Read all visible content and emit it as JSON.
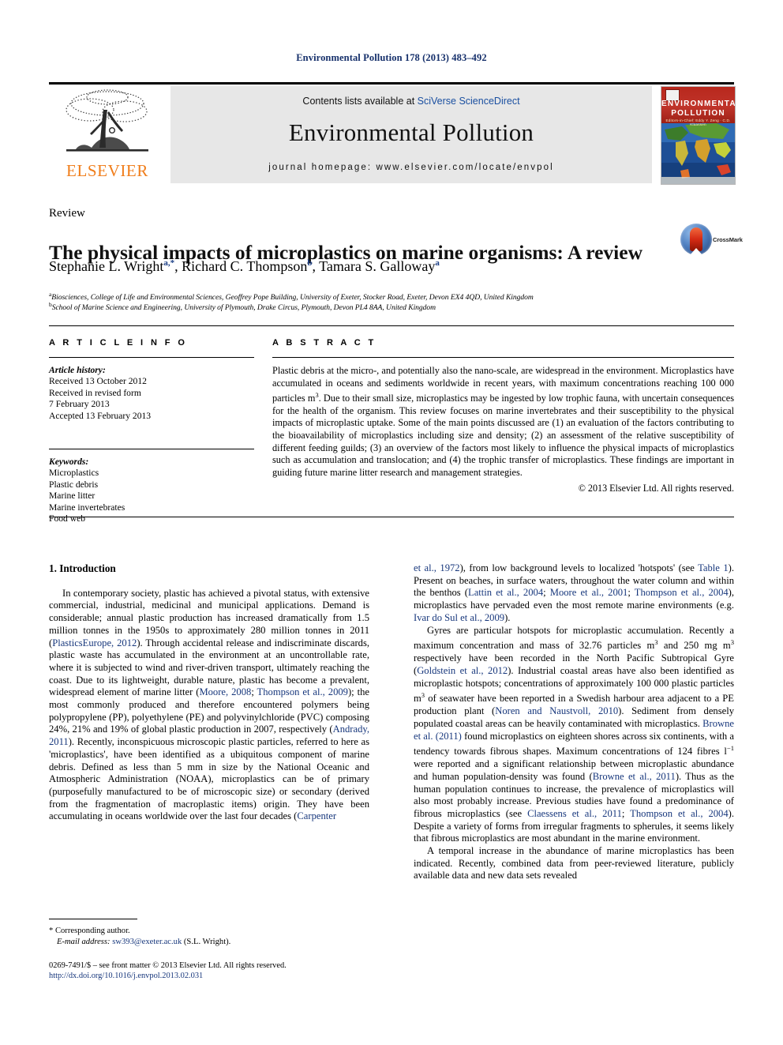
{
  "running_head": "Environmental Pollution 178 (2013) 483–492",
  "masthead": {
    "contents_prefix": "Contents lists available at ",
    "contents_link": "SciVerse ScienceDirect",
    "journal_title": "Environmental Pollution",
    "homepage": "journal homepage: www.elsevier.com/locate/envpol",
    "publisher_name": "ELSEVIER",
    "cover": {
      "line1": "ENVIRONMENTAL",
      "line2": "POLLUTION",
      "sub": "Editors-in-Chief:  Eddy Y. Zeng   · C.D. Klaassen"
    }
  },
  "article": {
    "type": "Review",
    "title": "The physical impacts of microplastics on marine organisms: A review",
    "crossmark_label": "CrossMark",
    "authors": [
      {
        "name": "Stephanie L. Wright",
        "marks": "a,*"
      },
      {
        "name": "Richard C. Thompson",
        "marks": "b"
      },
      {
        "name": "Tamara S. Galloway",
        "marks": "a"
      }
    ],
    "affiliations": [
      {
        "mark": "a",
        "text": "Biosciences, College of Life and Environmental Sciences, Geoffrey Pope Building, University of Exeter, Stocker Road, Exeter, Devon EX4 4QD, United Kingdom"
      },
      {
        "mark": "b",
        "text": "School of Marine Science and Engineering, University of Plymouth, Drake Circus, Plymouth, Devon PL4 8AA, United Kingdom"
      }
    ]
  },
  "article_info": {
    "heading": "A R T I C L E   I N F O",
    "history_label": "Article history:",
    "history": [
      "Received 13 October 2012",
      "Received in revised form",
      "7 February 2013",
      "Accepted 13 February 2013"
    ],
    "keywords_label": "Keywords:",
    "keywords": [
      "Microplastics",
      "Plastic debris",
      "Marine litter",
      "Marine invertebrates",
      "Food web"
    ]
  },
  "abstract": {
    "heading": "A B S T R A C T",
    "paragraph_1": "Plastic debris at the micro-, and potentially also the nano-scale, are widespread in the environment. Microplastics have accumulated in oceans and sediments worldwide in recent years, with maximum concentrations reaching 100 000 particles m",
    "paragraph_1_sup": "3",
    "paragraph_2": ". Due to their small size, microplastics may be ingested by low trophic fauna, with uncertain consequences for the health of the organism. This review focuses on marine invertebrates and their susceptibility to the physical impacts of microplastic uptake. Some of the main points discussed are (1) an evaluation of the factors contributing to the bioavailability of microplastics including size and density; (2) an assessment of the relative susceptibility of different feeding guilds; (3) an overview of the factors most likely to influence the physical impacts of microplastics such as accumulation and translocation; and (4) the trophic transfer of microplastics. These findings are important in guiding future marine litter research and management strategies.",
    "copyright": "© 2013 Elsevier Ltd. All rights reserved."
  },
  "body": {
    "section_title": "1. Introduction",
    "left": {
      "p1_a": "In contemporary society, plastic has achieved a pivotal status, with extensive commercial, industrial, medicinal and municipal applications. Demand is considerable; annual plastic production has increased dramatically from 1.5 million tonnes in the 1950s to approximately 280 million tonnes in 2011 (",
      "p1_ref1": "PlasticsEurope, 2012",
      "p1_b": "). Through accidental release and indiscriminate discards, plastic waste has accumulated in the environment at an uncontrollable rate, where it is subjected to wind and river-driven transport, ultimately reaching the coast. Due to its lightweight, durable nature, plastic has become a prevalent, widespread element of marine litter (",
      "p1_ref2": "Moore, 2008",
      "p1_c": "; ",
      "p1_ref3": "Thompson et al., 2009",
      "p1_d": "); the most commonly produced and therefore encountered polymers being polypropylene (PP), polyethylene (PE) and polyvinylchloride (PVC) composing 24%, 21% and 19% of global plastic production in 2007, respectively (",
      "p1_ref4": "Andrady, 2011",
      "p1_e": "). Recently, inconspicuous microscopic plastic particles, referred to here as 'microplastics', have been identified as a ubiquitous component of marine debris. Defined as less than 5 mm in size by the National Oceanic and Atmospheric Administration (NOAA), microplastics can be of primary (purposefully manufactured to be of microscopic size) or secondary (derived from the fragmentation of macroplastic items) origin. They have been accumulating in oceans worldwide over the last four decades (",
      "p1_ref5": "Carpenter"
    },
    "right": {
      "p1_a": "et al., 1972",
      "p1_b": "), from low background levels to localized 'hotspots' (see ",
      "p1_ref_table": "Table 1",
      "p1_c": "). Present on beaches, in surface waters, throughout the water column and within the benthos (",
      "p1_ref1": "Lattin et al., 2004",
      "p1_d": "; ",
      "p1_ref2": "Moore et al., 2001",
      "p1_e": "; ",
      "p1_ref3": "Thompson et al., 2004",
      "p1_f": "), microplastics have pervaded even the most remote marine environments (e.g. ",
      "p1_ref4": "Ivar do Sul et al., 2009",
      "p1_g": ").",
      "p2_a": "Gyres are particular hotspots for microplastic accumulation. Recently a maximum concentration and mass of 32.76 particles m",
      "p2_sup1": "3",
      "p2_b": " and 250 mg m",
      "p2_sup2": "3",
      "p2_c": " respectively have been recorded in the North Pacific Subtropical Gyre (",
      "p2_ref1": "Goldstein et al., 2012",
      "p2_d": "). Industrial coastal areas have also been identified as microplastic hotspots; concentrations of approximately 100 000 plastic particles m",
      "p2_sup3": "3",
      "p2_e": " of seawater have been reported in a Swedish harbour area adjacent to a PE production plant (",
      "p2_ref2": "Noren and Naustvoll, 2010",
      "p2_f": "). Sediment from densely populated coastal areas can be heavily contaminated with microplastics. ",
      "p2_ref3": "Browne et al. (2011)",
      "p2_g": " found microplastics on eighteen shores across six continents, with a tendency towards fibrous shapes. Maximum concentrations of 124 fibres l",
      "p2_sup4": "−1",
      "p2_h": " were reported and a significant relationship between microplastic abundance and human population-density was found (",
      "p2_ref4": "Browne et al., 2011",
      "p2_i": "). Thus as the human population continues to increase, the prevalence of microplastics will also most probably increase. Previous studies have found a predominance of fibrous microplastics (see ",
      "p2_ref5": "Claessens et al., 2011",
      "p2_j": "; ",
      "p2_ref6": "Thompson et al., 2004",
      "p2_k": "). Despite a variety of forms from irregular fragments to spherules, it seems likely that fibrous microplastics are most abundant in the marine environment.",
      "p3": "A temporal increase in the abundance of marine microplastics has been indicated. Recently, combined data from peer-reviewed literature, publicly available data and new data sets revealed"
    }
  },
  "footnotes": {
    "corresponding": "* Corresponding author.",
    "email_label": "E-mail address:",
    "email": "sw393@exeter.ac.uk",
    "email_suffix": "(S.L. Wright)."
  },
  "imprint": {
    "line1": "0269-7491/$ – see front matter © 2013 Elsevier Ltd. All rights reserved.",
    "doi": "http://dx.doi.org/10.1016/j.envpol.2013.02.031"
  }
}
